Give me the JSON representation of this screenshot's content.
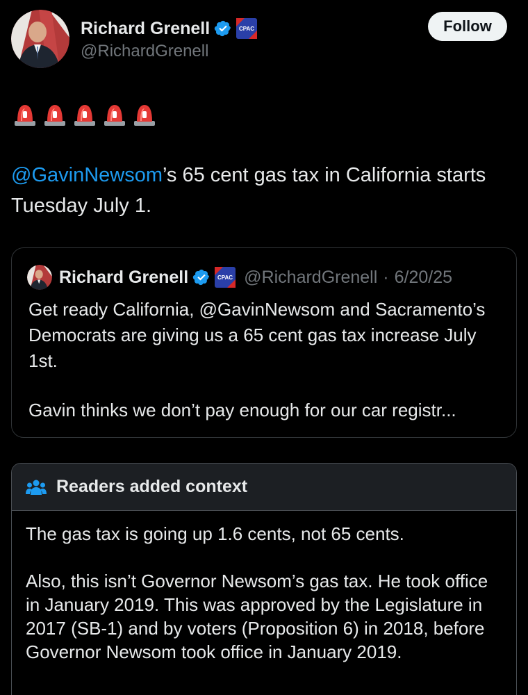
{
  "author": {
    "name": "Richard Grenell",
    "handle": "@RichardGrenell",
    "follow_label": "Follow",
    "badges": [
      "verified-icon",
      "cpac-affiliate-badge"
    ]
  },
  "tweet": {
    "sirens": [
      "police-light-emoji",
      "police-light-emoji",
      "police-light-emoji",
      "police-light-emoji",
      "police-light-emoji"
    ],
    "mention": "@GavinNewsom",
    "text": "’s 65 cent gas tax in California starts Tuesday July 1."
  },
  "quote": {
    "name": "Richard Grenell",
    "handle": "@RichardGrenell",
    "separator": "·",
    "date": "6/20/25",
    "paragraph1": "Get ready California, @GavinNewsom and Sacramento’s Democrats are giving us a 65 cent gas tax increase July 1st.",
    "paragraph2": "Gavin thinks we don’t pay enough for our car registr..."
  },
  "community_note": {
    "title": "Readers added context",
    "icon": "people-icon",
    "paragraph1": "The gas tax is going up 1.6 cents, not 65 cents.",
    "paragraph2": "Also, this isn’t Governor Newsom’s gas tax. He took office in January 2019. This was approved by the Legislature in 2017 (SB-1) and by voters (Proposition 6) in 2018, before Governor Newsom took office in January 2019."
  },
  "colors": {
    "background": "#000000",
    "text": "#e7e9ea",
    "secondary": "#71767b",
    "link": "#1d9bf0",
    "verified": "#1d9bf0",
    "cpac_badge": "#2a3fa8"
  }
}
